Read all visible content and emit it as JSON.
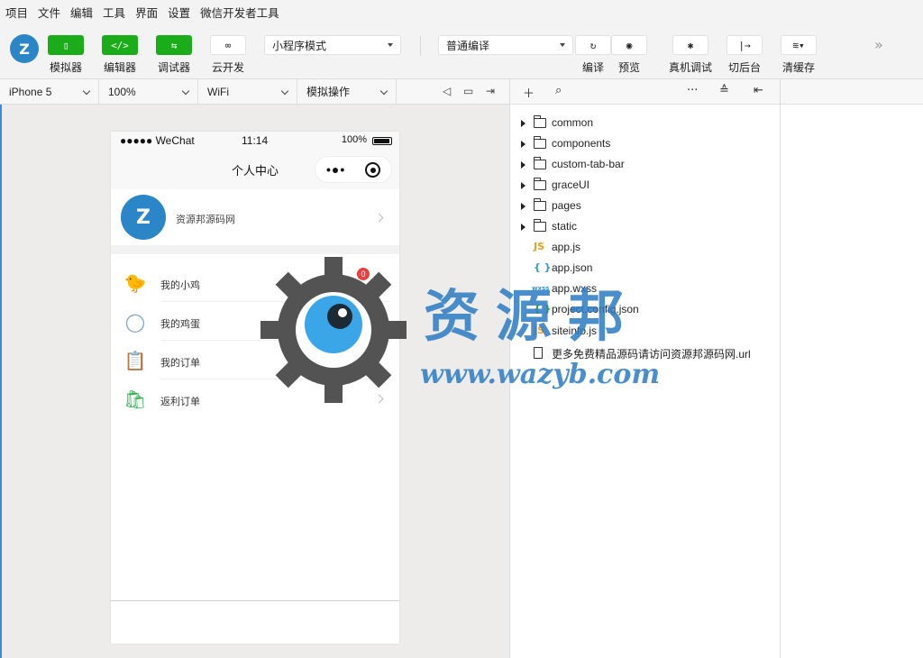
{
  "menubar": {
    "items": [
      "项目",
      "文件",
      "编辑",
      "工具",
      "界面",
      "设置",
      "微信开发者工具"
    ]
  },
  "toolbar": {
    "simulator_label": "模拟器",
    "editor_label": "编辑器",
    "debugger_label": "调试器",
    "cloud_label": "云开发",
    "mode_select": "小程序模式",
    "compile_select": "普通编译",
    "compile_label": "编译",
    "preview_label": "预览",
    "remote_debug_label": "真机调试",
    "background_label": "切后台",
    "clear_cache_label": "清缓存"
  },
  "subbar": {
    "device": "iPhone 5",
    "zoom": "100%",
    "network": "WiFi",
    "operation": "模拟操作"
  },
  "phone": {
    "carrier": "●●●●● WeChat",
    "time": "11:14",
    "battery": "100%",
    "nav_title": "个人中心",
    "profile_name": "资源邦源码网",
    "menu": [
      {
        "label": "我的小鸡",
        "icon": "chick-icon",
        "badge": "0"
      },
      {
        "label": "我的鸡蛋",
        "icon": "egg-icon"
      },
      {
        "label": "我的订单",
        "icon": "clipboard-icon"
      },
      {
        "label": "返利订单",
        "icon": "shopping-bag-icon"
      }
    ]
  },
  "watermark": {
    "title": "资源邦",
    "url": "www.wazyb.com"
  },
  "files": {
    "folders": [
      "common",
      "components",
      "custom-tab-bar",
      "graceUI",
      "pages",
      "static"
    ],
    "items": [
      {
        "name": "app.js",
        "type": "JS",
        "color": "#f0a020"
      },
      {
        "name": "app.json",
        "type": "{ }",
        "color": "#2a9ad6"
      },
      {
        "name": "app.wxss",
        "type": "wxss",
        "color": "#2a9ad6"
      },
      {
        "name": "project.config.json",
        "type": "{ }",
        "color": "#1aad19"
      },
      {
        "name": "siteinfo.js",
        "type": "JS",
        "color": "#f0a020"
      },
      {
        "name": "更多免费精品源码请访问资源邦源码网.url",
        "type": "doc",
        "color": "#333333"
      }
    ]
  }
}
